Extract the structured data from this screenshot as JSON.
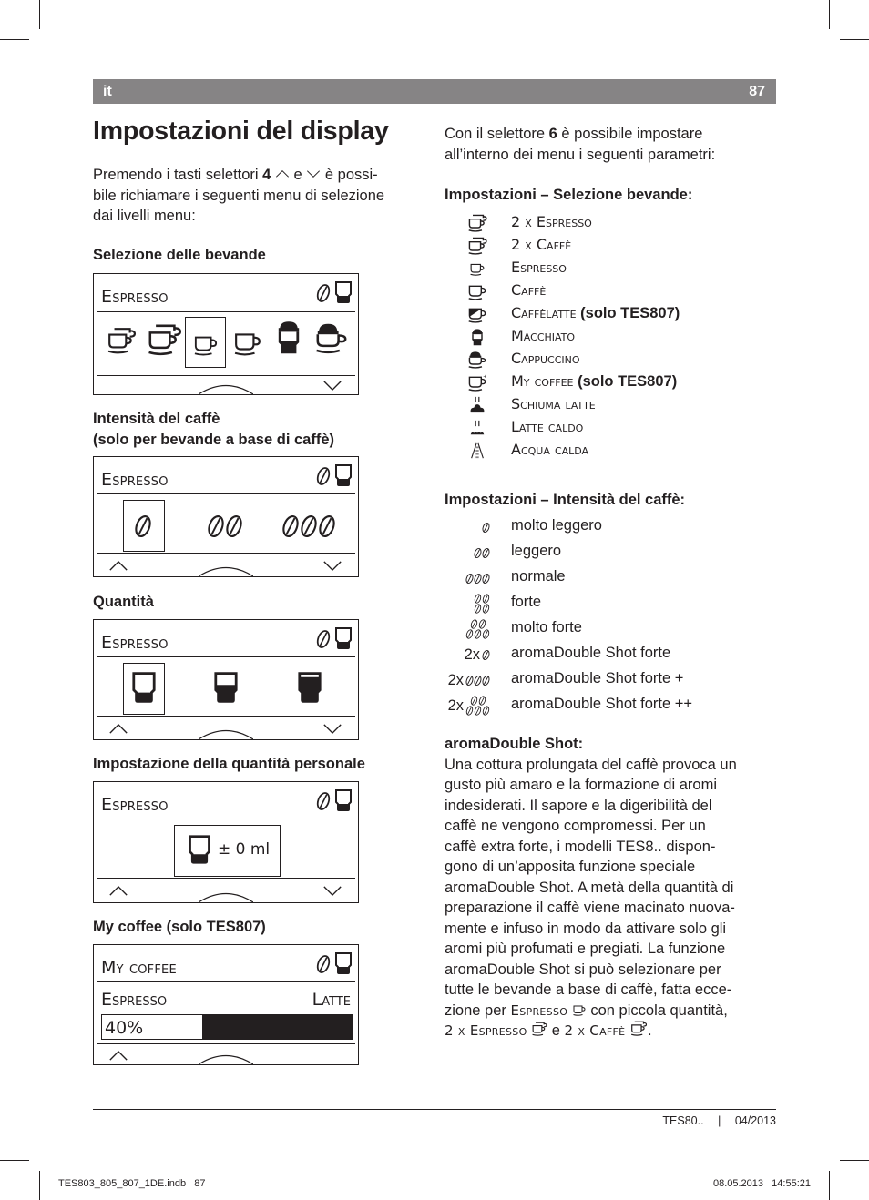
{
  "header": {
    "lang": "it",
    "page_number": "87"
  },
  "title": "Impostazioni del display",
  "left": {
    "intro_pre": "Premendo i tasti selettori ",
    "intro_key": "4",
    "intro_mid": " e ",
    "intro_post": " è possi-",
    "intro_line2": "bile richiamare i seguenti menu di selezione",
    "intro_line3": "dai livelli menu:",
    "sections": [
      {
        "heading": "Selezione delle bevande",
        "display_title": "Espresso"
      },
      {
        "heading": "Intensità del caffè",
        "heading2": "(solo per bevande a base di caffè)",
        "display_title": "Espresso"
      },
      {
        "heading": "Quantità",
        "display_title": "Espresso"
      },
      {
        "heading": "Impostazione della quantità personale",
        "display_title": "Espresso",
        "value": "± 0 ml"
      },
      {
        "heading": "My coffee (solo TES807)",
        "display_title": "My coffee",
        "left_label": "Espresso",
        "right_label": "Latte",
        "percent_label": "40%",
        "percent": 40
      }
    ]
  },
  "right": {
    "intro_pre": "Con il selettore ",
    "intro_key": "6",
    "intro_post": " è possibile impostare",
    "intro_line2": "all’interno dei menu i seguenti parametri:",
    "beverages_heading": "Impostazioni – Selezione bevande:",
    "beverages": [
      {
        "icon": "double-espresso-cup-icon",
        "label": "2 x Espresso",
        "note": ""
      },
      {
        "icon": "double-coffee-cup-icon",
        "label": "2 x Caffè",
        "note": ""
      },
      {
        "icon": "espresso-cup-icon",
        "label": "Espresso",
        "note": ""
      },
      {
        "icon": "coffee-cup-icon",
        "label": "Caffè",
        "note": ""
      },
      {
        "icon": "caffelatte-cup-icon",
        "label": "Caffèlatte",
        "note": " (solo TES807)"
      },
      {
        "icon": "macchiato-glass-icon",
        "label": "Macchiato",
        "note": ""
      },
      {
        "icon": "cappuccino-cup-icon",
        "label": "Cappuccino",
        "note": ""
      },
      {
        "icon": "my-coffee-cup-icon",
        "label": "My coffee",
        "note": " (solo TES807)"
      },
      {
        "icon": "milk-foam-icon",
        "label": "Schiuma latte",
        "note": ""
      },
      {
        "icon": "warm-milk-icon",
        "label": "Latte caldo",
        "note": ""
      },
      {
        "icon": "hot-water-icon",
        "label": "Acqua calda",
        "note": ""
      }
    ],
    "intensity_heading": "Impostazioni – Intensità del caffè:",
    "intensity": [
      {
        "prefix": "",
        "beans": 1,
        "label": "molto leggero"
      },
      {
        "prefix": "",
        "beans": 2,
        "label": "leggero"
      },
      {
        "prefix": "",
        "beans": 3,
        "label": "normale"
      },
      {
        "prefix": "",
        "beans": 4,
        "label": "forte"
      },
      {
        "prefix": "",
        "beans": 5,
        "label": "molto forte"
      },
      {
        "prefix": "2x",
        "beans": 1,
        "label": "aromaDouble Shot forte"
      },
      {
        "prefix": "2x",
        "beans": 3,
        "label": "aromaDouble Shot forte +"
      },
      {
        "prefix": "2x",
        "beans": 5,
        "label": "aromaDouble Shot forte ++"
      }
    ],
    "ads_heading": "aromaDouble Shot:",
    "ads_lines": [
      "Una cottura prolungata del caffè provoca un",
      "gusto più amaro e la formazione di aromi",
      "indesiderati. Il sapore e la digeribilità del",
      "caffè ne vengono compromessi. Per un",
      "caffè extra forte, i modelli TES8.. dispon-",
      "gono di un’apposita funzione speciale",
      "aromaDouble Shot. A metà della quantità di",
      "preparazione il caffè viene macinato nuova-",
      "mente e infuso in modo da attivare solo gli",
      "aromi più profumati e pregiati. La funzione",
      "aromaDouble Shot si può selezionare per",
      "tutte le bevande a base di caffè, fatta ecce-"
    ],
    "ads_last1_pre": "zione per ",
    "ads_last1_sc": "Espresso",
    "ads_last1_post": " con piccola quantità,",
    "ads_last2_a": "2 x Espresso",
    "ads_last2_mid": " e ",
    "ads_last2_b": "2 x Caffè",
    "ads_last2_end": "."
  },
  "footer": {
    "model": "TES80..",
    "separator": "|",
    "date": "04/2013"
  },
  "slug": {
    "file": "TES803_805_807_1DE.indb   87",
    "timestamp": "08.05.2013   14:55:21"
  }
}
